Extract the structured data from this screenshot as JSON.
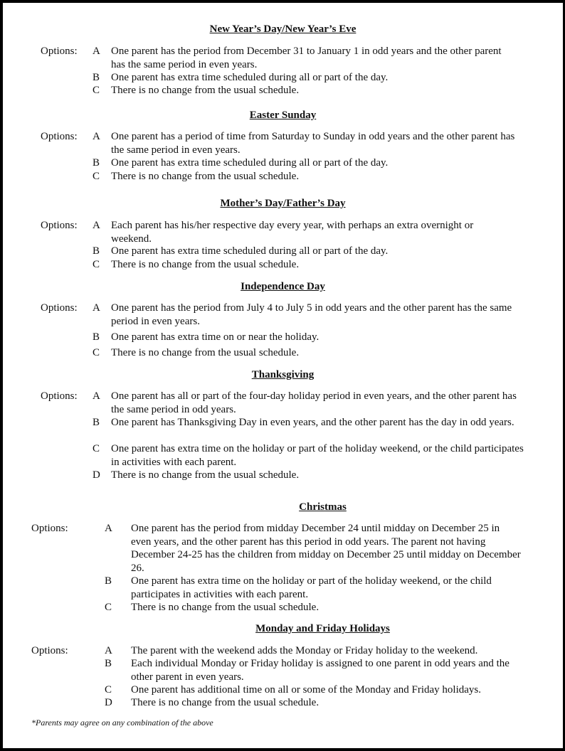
{
  "sections": [
    {
      "title": "New Year’s Day/New Year’s Eve",
      "options_label": "Options:",
      "options": [
        {
          "letter": "A",
          "text": "One parent has the period from December 31 to January 1 in odd years and the other parent has the same period in even years."
        },
        {
          "letter": "B",
          "text": "One parent has extra time scheduled during all or part of the day."
        },
        {
          "letter": "C",
          "text": "There is no change from the usual schedule."
        }
      ]
    },
    {
      "title": "Easter Sunday",
      "options_label": "Options:",
      "options": [
        {
          "letter": "A",
          "text": "One parent has a period of time from Saturday to Sunday in odd years and the other parent has the same period in even years."
        },
        {
          "letter": "B",
          "text": "One parent has extra time scheduled during all or part of the day."
        },
        {
          "letter": "C",
          "text": "There is no change from the usual schedule."
        }
      ]
    },
    {
      "title": "Mother’s Day/Father’s Day",
      "options_label": "Options:",
      "options": [
        {
          "letter": "A",
          "text": "Each parent has his/her respective day every year, with perhaps an extra overnight or weekend."
        },
        {
          "letter": "B",
          "text": "One parent has extra time scheduled during all or part of the day."
        },
        {
          "letter": "C",
          "text": "There is no change from the usual schedule."
        }
      ]
    },
    {
      "title": "Independence Day",
      "options_label": "Options:",
      "options": [
        {
          "letter": "A",
          "text": "One parent has the period from July 4 to July 5 in odd years and the other parent has the same period in even years."
        },
        {
          "letter": "B",
          "text": "One parent has extra time on or near the holiday."
        },
        {
          "letter": "C",
          "text": "There is no change from the usual schedule."
        }
      ]
    },
    {
      "title": "Thanksgiving",
      "options_label": "Options:",
      "options": [
        {
          "letter": "A",
          "text": "One parent has all or part of the four-day holiday period in even years, and the other parent has the same period in odd years."
        },
        {
          "letter": "B",
          "text": "One parent has Thanksgiving Day in even years, and the other parent has the day in odd years."
        },
        {
          "letter": "C",
          "text": "One parent has extra time on the holiday or part of the holiday weekend, or the child participates in activities with each parent."
        },
        {
          "letter": "D",
          "text": "There is no change from the usual schedule."
        }
      ]
    },
    {
      "title": "Christmas",
      "options_label": "Options:",
      "options": [
        {
          "letter": "A",
          "text": "One parent has the period from midday December 24 until midday on December 25 in even years, and the other parent has this period in odd years.  The parent not having December 24-25 has the children from midday on December 25 until midday on December 26."
        },
        {
          "letter": "B",
          "text": "One parent has extra time on the holiday or part of the holiday weekend, or the child participates in activities with each parent."
        },
        {
          "letter": "C",
          "text": "There is no change from the usual schedule."
        }
      ]
    },
    {
      "title": "Monday and Friday Holidays",
      "options_label": "Options:",
      "options": [
        {
          "letter": "A",
          "text": "The parent with the weekend adds the Monday or Friday holiday to the weekend."
        },
        {
          "letter": "B",
          "text": "Each individual Monday or Friday holiday is assigned to one parent in odd years and the other parent in even years."
        },
        {
          "letter": "C",
          "text": "One parent has additional time on all or some of the Monday and Friday holidays."
        },
        {
          "letter": "D",
          "text": "There is no change from the usual schedule."
        }
      ]
    }
  ],
  "footnote": "*Parents may agree on any combination of the above"
}
